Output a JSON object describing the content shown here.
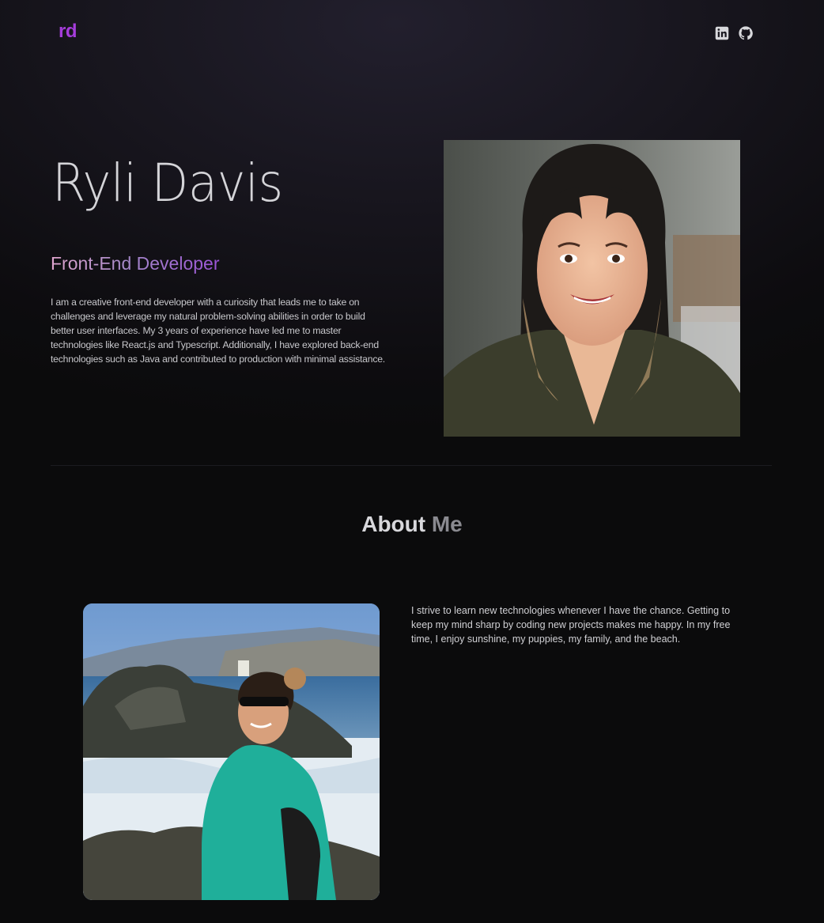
{
  "header": {
    "logo": "rd",
    "social": [
      {
        "icon": "linkedin-icon"
      },
      {
        "icon": "github-icon"
      }
    ]
  },
  "hero": {
    "name": "Ryli Davis",
    "role": "Front-End Developer",
    "description": "I am a creative front-end developer with a curiosity that leads me to take on challenges and leverage my natural problem-solving abilities in order to build better user interfaces. My 3 years of experience have led me to master technologies like React.js and Typescript. Additionally, I have explored back-end technologies such as Java and contributed to production with minimal assistance."
  },
  "about": {
    "title_main": "About",
    "title_muted": "Me",
    "text": "I strive to learn new technologies whenever I have the chance. Getting to keep my mind sharp by coding new projects makes me happy. In my free time, I enjoy sunshine, my puppies, my family, and the beach."
  },
  "colors": {
    "accent": "#a53ddb",
    "background": "#0b0b0c",
    "role_gradient_start": "#e0a5cf",
    "role_gradient_end": "#9c53d8"
  }
}
